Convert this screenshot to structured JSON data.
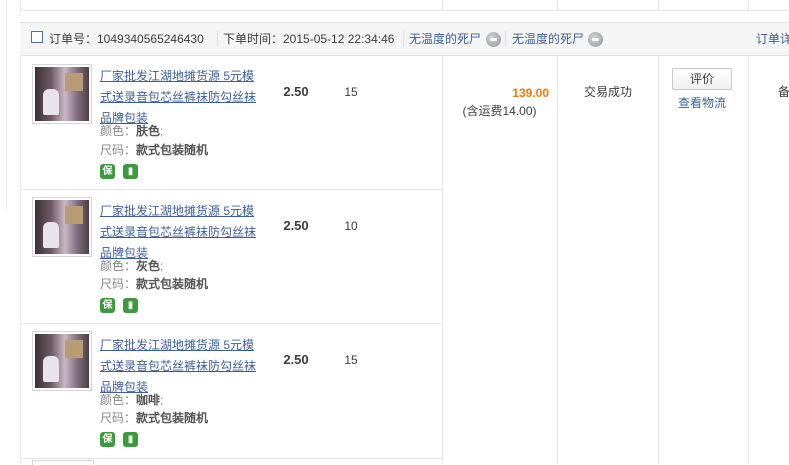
{
  "order": {
    "label_no": "订单号：",
    "order_no": "1049340565246430",
    "label_time": "下单时间：",
    "time": "2015-05-12 22:34:46",
    "seller1": "无温度的死尸",
    "seller2": "无温度的死尸",
    "detail_link": "订单详"
  },
  "items": [
    {
      "title": "厂家批发江湖地摊货源 5元模式送录音包芯丝裤袜防勾丝袜品牌包装",
      "color_label": "颜色：",
      "color": "肤色",
      "size_label": "尺码：",
      "size": "款式包装随机",
      "price": "2.50",
      "qty": "15"
    },
    {
      "title": "厂家批发江湖地摊货源 5元模式送录音包芯丝裤袜防勾丝袜品牌包装",
      "color_label": "颜色：",
      "color": "灰色",
      "size_label": "尺码：",
      "size": "款式包装随机",
      "price": "2.50",
      "qty": "10"
    },
    {
      "title": "厂家批发江湖地摊货源 5元模式送录音包芯丝裤袜防勾丝袜品牌包装",
      "color_label": "颜色：",
      "color": "咖啡",
      "size_label": "尺码：",
      "size": "款式包装随机",
      "price": "2.50",
      "qty": "15"
    }
  ],
  "badges": {
    "bao": "保",
    "truck": "▮"
  },
  "summary": {
    "total": "139.00",
    "shipping": "(含运费14.00)",
    "status": "交易成功",
    "rate_button": "评价",
    "logistics_link": "查看物流",
    "remark": "备"
  },
  "colors": {
    "accent_orange": "#f27b04",
    "link_blue": "#3c5f9a",
    "badge_green": "#3b9a3b"
  }
}
